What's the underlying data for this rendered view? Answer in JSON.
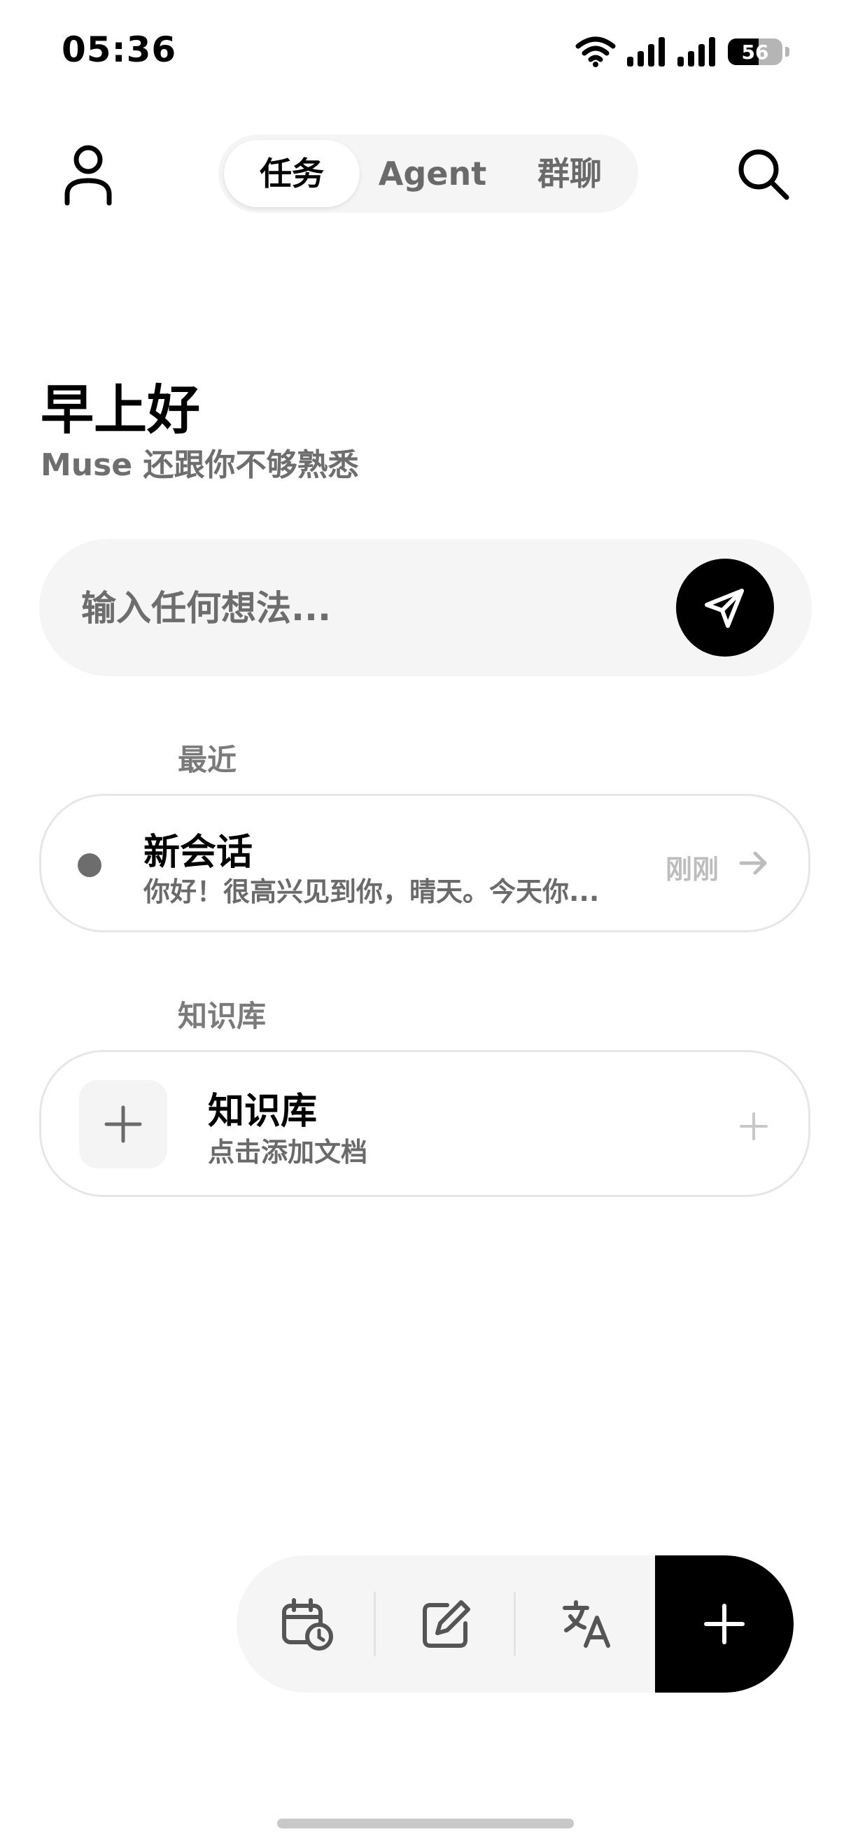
{
  "status_bar": {
    "time": "05:36",
    "battery": "56",
    "battery_level": 0.56,
    "icons": [
      "wifi-icon",
      "signal-icon",
      "signal-icon",
      "battery-icon"
    ]
  },
  "nav": {
    "tabs": [
      {
        "label": "任务",
        "active": true
      },
      {
        "label": "Agent",
        "active": false
      },
      {
        "label": "群聊",
        "active": false
      }
    ],
    "profile_icon": "profile-icon",
    "search_icon": "search-icon"
  },
  "greeting": {
    "title": "早上好",
    "subtitle": "Muse 还跟你不够熟悉"
  },
  "input": {
    "placeholder": "输入任何想法...",
    "value": "",
    "send_icon": "send-icon"
  },
  "recent": {
    "section_label": "最近",
    "items": [
      {
        "title": "新会话",
        "preview": "你好！很高兴见到你，晴天。今天你...",
        "time": "刚刚"
      }
    ]
  },
  "knowledge": {
    "section_label": "知识库",
    "card_title": "知识库",
    "card_subtitle": "点击添加文档"
  },
  "toolbar": {
    "icons": [
      "calendar-clock-icon",
      "edit-icon",
      "translate-icon",
      "plus-icon"
    ]
  },
  "colors": {
    "background": "#ffffff",
    "surface": "#f5f5f5",
    "primary": "#000000",
    "muted_text": "#6e6e6e",
    "faint_text": "#bdbdbd"
  }
}
